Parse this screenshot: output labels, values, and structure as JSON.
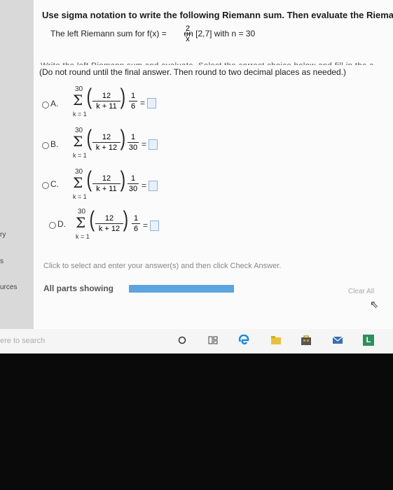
{
  "sidebar": {
    "labels": [
      "ry",
      "s",
      "urces"
    ]
  },
  "question": {
    "title": "Use sigma notation to write the following Riemann sum. Then evaluate the Riemann su",
    "function_prefix": "The left Riemann sum for f(x) =",
    "function_num": "2",
    "function_den": "x",
    "function_suffix": "on [2,7] with n = 30",
    "cut_text": "Write the left Riemann sum and evaluate. Select the correct choice below and fill in the a",
    "instructions": "(Do not round until the final answer. Then round to two decimal places as needed.)"
  },
  "options": [
    {
      "label": "A.",
      "upper": "30",
      "lower": "k = 1",
      "num": "12",
      "den": "k + 11",
      "mult_num": "1",
      "mult_den": "6"
    },
    {
      "label": "B.",
      "upper": "30",
      "lower": "k = 1",
      "num": "12",
      "den": "k + 12",
      "mult_num": "1",
      "mult_den": "30"
    },
    {
      "label": "C.",
      "upper": "30",
      "lower": "k = 1",
      "num": "12",
      "den": "k + 11",
      "mult_num": "1",
      "mult_den": "30"
    },
    {
      "label": "D.",
      "upper": "30",
      "lower": "k = 1",
      "num": "12",
      "den": "k + 12",
      "mult_num": "1",
      "mult_den": "6"
    }
  ],
  "symbols": {
    "sigma": "Σ",
    "lparen": "(",
    "rparen": ")",
    "equals": "=",
    "cursor": "⇖"
  },
  "footer": {
    "click_message": "Click to select and enter your answer(s) and then click Check Answer.",
    "parts_label": "All parts showing",
    "progress": 1.0,
    "clear_all": "Clear All"
  },
  "taskbar": {
    "search_text": "ere to search",
    "icons": [
      "cortana-icon",
      "task-view-icon",
      "edge-icon",
      "file-explorer-icon",
      "store-icon",
      "mail-icon",
      "app-icon"
    ]
  },
  "colors": {
    "progress": "#5ca4df",
    "answer_box": "#e8f1fb",
    "edge": "#1e88d6",
    "store": "#c89b1c",
    "explorer": "#e8c13a"
  }
}
